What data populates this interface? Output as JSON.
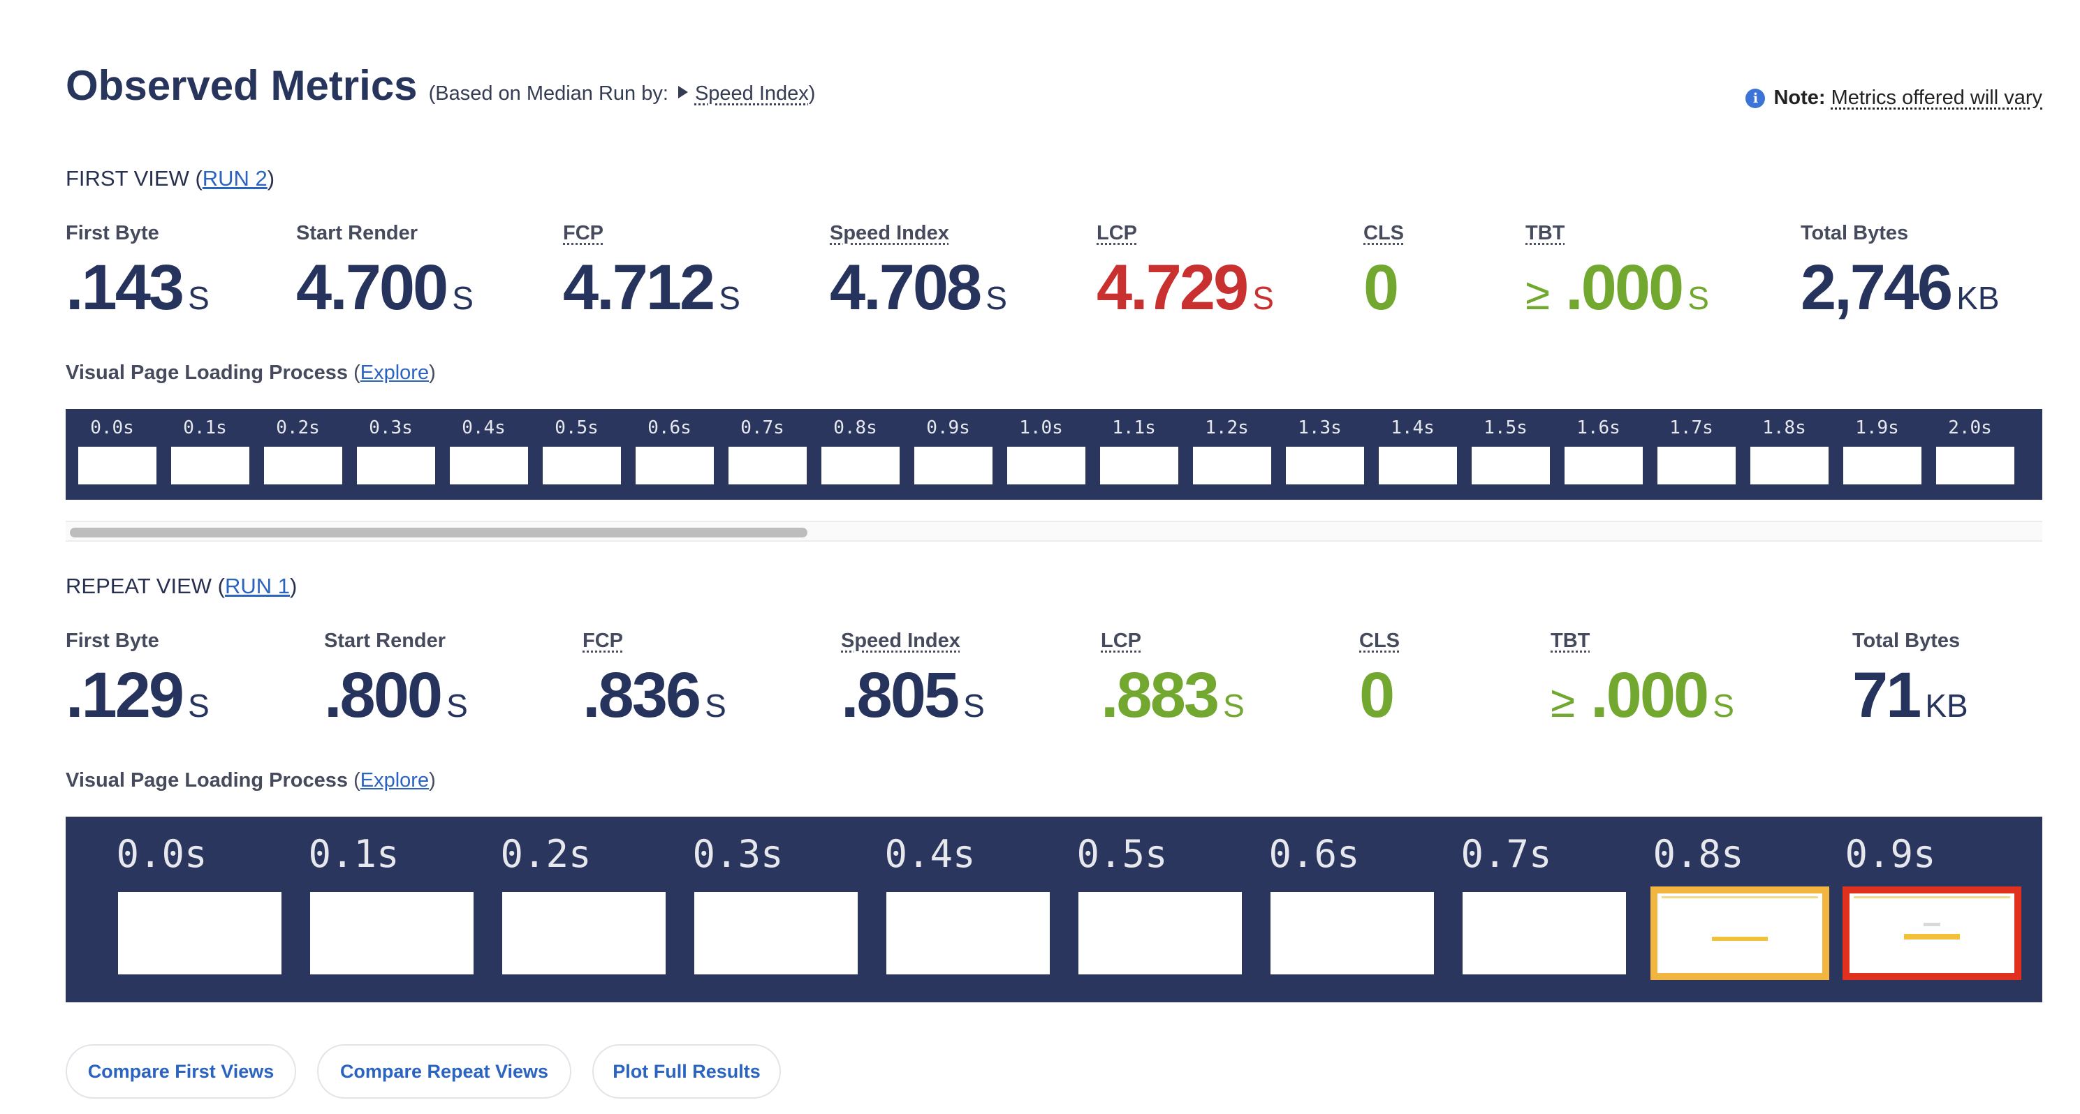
{
  "header": {
    "title": "Observed Metrics",
    "sub_prefix": "(Based on Median Run by:",
    "sub_link": "Speed Index",
    "sub_suffix": ")",
    "note_bold": "Note:",
    "note_text": "Metrics offered will vary"
  },
  "first_view": {
    "label_prefix": "FIRST VIEW (",
    "run_link": "RUN 2",
    "label_suffix": ")",
    "metrics": [
      {
        "label": "First Byte",
        "value": ".143",
        "unit": "S",
        "color": "#26335c"
      },
      {
        "label": "Start Render",
        "value": "4.700",
        "unit": "S",
        "color": "#26335c"
      },
      {
        "label": "FCP",
        "value": "4.712",
        "unit": "S",
        "color": "#26335c"
      },
      {
        "label": "Speed Index",
        "value": "4.708",
        "unit": "S",
        "color": "#26335c"
      },
      {
        "label": "LCP",
        "value": "4.729",
        "unit": "S",
        "color": "#c93030"
      },
      {
        "label": "CLS",
        "value": "0",
        "unit": "",
        "color": "#72a830"
      },
      {
        "label": "TBT",
        "prefix": "≥",
        "value": ".000",
        "unit": "S",
        "color": "#72a830"
      },
      {
        "label": "Total Bytes",
        "value": "2,746",
        "unit": "KB",
        "color": "#26335c"
      }
    ],
    "vpl_label": "Visual Page Loading Process",
    "explore": "Explore",
    "frames": [
      "0.0s",
      "0.1s",
      "0.2s",
      "0.3s",
      "0.4s",
      "0.5s",
      "0.6s",
      "0.7s",
      "0.8s",
      "0.9s",
      "1.0s",
      "1.1s",
      "1.2s",
      "1.3s",
      "1.4s",
      "1.5s",
      "1.6s",
      "1.7s",
      "1.8s",
      "1.9s",
      "2.0s"
    ]
  },
  "repeat_view": {
    "label_prefix": "REPEAT VIEW (",
    "run_link": "RUN 1",
    "label_suffix": ")",
    "metrics": [
      {
        "label": "First Byte",
        "value": ".129",
        "unit": "S",
        "color": "#26335c"
      },
      {
        "label": "Start Render",
        "value": ".800",
        "unit": "S",
        "color": "#26335c"
      },
      {
        "label": "FCP",
        "value": ".836",
        "unit": "S",
        "color": "#26335c"
      },
      {
        "label": "Speed Index",
        "value": ".805",
        "unit": "S",
        "color": "#26335c"
      },
      {
        "label": "LCP",
        "value": ".883",
        "unit": "S",
        "color": "#72a830"
      },
      {
        "label": "CLS",
        "value": "0",
        "unit": "",
        "color": "#72a830"
      },
      {
        "label": "TBT",
        "prefix": "≥",
        "value": ".000",
        "unit": "S",
        "color": "#72a830"
      },
      {
        "label": "Total Bytes",
        "value": "71",
        "unit": "KB",
        "color": "#26335c"
      }
    ],
    "vpl_label": "Visual Page Loading Process",
    "explore": "Explore",
    "frames": [
      "0.0s",
      "0.1s",
      "0.2s",
      "0.3s",
      "0.4s",
      "0.5s",
      "0.6s",
      "0.7s",
      "0.8s",
      "0.9s"
    ]
  },
  "buttons": {
    "compare_first": "Compare First Views",
    "compare_repeat": "Compare Repeat Views",
    "plot_full": "Plot Full Results"
  },
  "colors": {
    "strip_bg": "#2a365d",
    "highlight_changed": "#f2b640",
    "highlight_lcp": "#e0301e",
    "link": "#2b64c0"
  }
}
